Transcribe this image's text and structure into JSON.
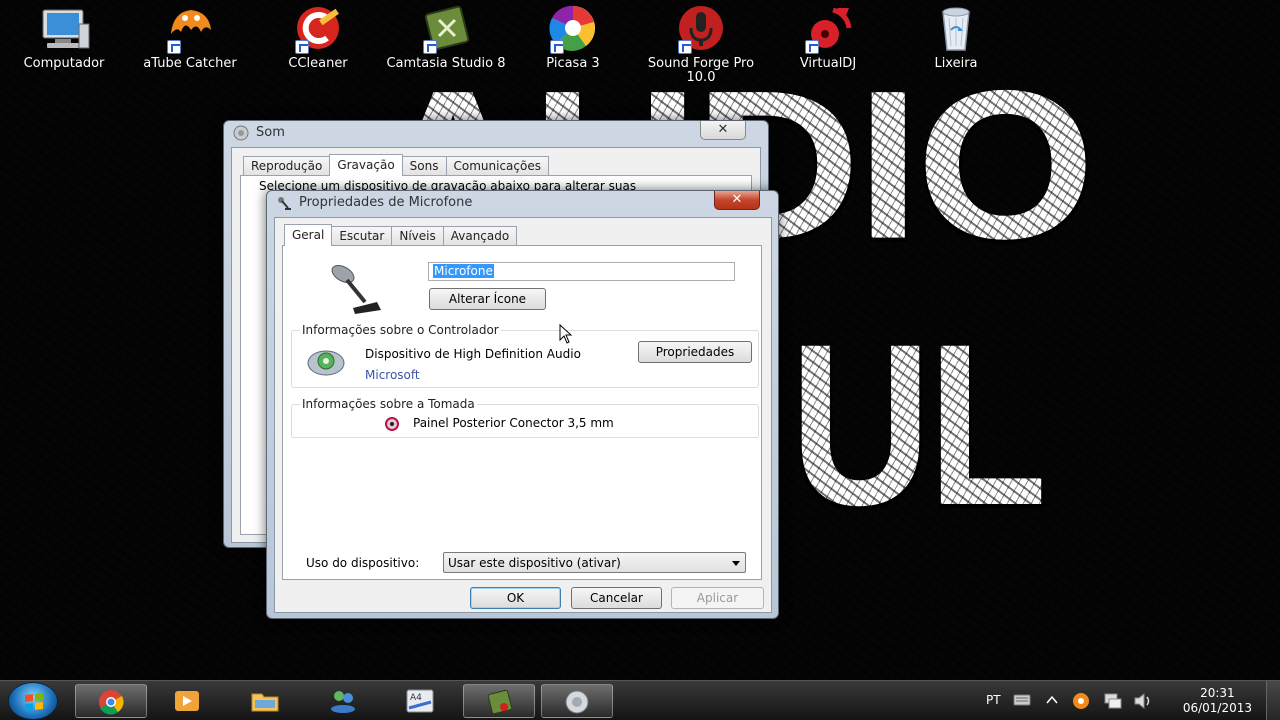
{
  "wallpaper": {
    "top_text": "AUDIO",
    "bottom_text": "UL"
  },
  "desktop_icons": [
    {
      "label": "Computador",
      "icon": "computer-icon",
      "shortcut": false
    },
    {
      "label": "aTube Catcher",
      "icon": "atube-catcher-icon",
      "shortcut": true
    },
    {
      "label": "CCleaner",
      "icon": "ccleaner-icon",
      "shortcut": true
    },
    {
      "label": "Camtasia Studio 8",
      "icon": "camtasia-icon",
      "shortcut": true
    },
    {
      "label": "Picasa 3",
      "icon": "picasa-icon",
      "shortcut": true
    },
    {
      "label": "Sound Forge Pro 10.0",
      "icon": "sound-forge-icon",
      "shortcut": true
    },
    {
      "label": "VirtualDJ",
      "icon": "virtualdj-icon",
      "shortcut": true
    },
    {
      "label": "Lixeira",
      "icon": "recycle-bin-icon",
      "shortcut": false
    }
  ],
  "som_window": {
    "title": "Som",
    "close_label": "✕",
    "tabs": [
      "Reprodução",
      "Gravação",
      "Sons",
      "Comunicações"
    ],
    "active_tab": "Gravação",
    "instruction": "Selecione um dispositivo de gravação abaixo para alterar suas"
  },
  "mic_dialog": {
    "title": "Propriedades de Microfone",
    "close_label": "✕",
    "tabs": [
      "Geral",
      "Escutar",
      "Níveis",
      "Avançado"
    ],
    "active_tab": "Geral",
    "device_name": "Microfone",
    "change_icon_label": "Alterar Ícone",
    "controller_group": "Informações sobre o Controlador",
    "controller_name": "Dispositivo de High Definition Audio",
    "controller_vendor": "Microsoft",
    "properties_label": "Propriedades",
    "jack_group": "Informações sobre a Tomada",
    "jack_info": "Painel Posterior Conector 3,5 mm",
    "jack_color": "#b0184a",
    "usage_label": "Uso do dispositivo:",
    "usage_value": "Usar este dispositivo (ativar)",
    "ok_label": "OK",
    "cancel_label": "Cancelar",
    "apply_label": "Aplicar"
  },
  "taskbar": {
    "items": [
      {
        "name": "chrome",
        "icon": "chrome-icon",
        "active": true
      },
      {
        "name": "media-player",
        "icon": "media-player-icon",
        "active": false
      },
      {
        "name": "explorer",
        "icon": "folder-icon",
        "active": false
      },
      {
        "name": "network",
        "icon": "network-users-icon",
        "active": false
      },
      {
        "name": "fonts",
        "icon": "font-tool-icon",
        "active": false
      },
      {
        "name": "camtasia",
        "icon": "camtasia-icon",
        "active": true
      },
      {
        "name": "sound",
        "icon": "speaker-icon",
        "active": true
      }
    ],
    "language": "PT",
    "time": "20:31",
    "date": "06/01/2013"
  }
}
